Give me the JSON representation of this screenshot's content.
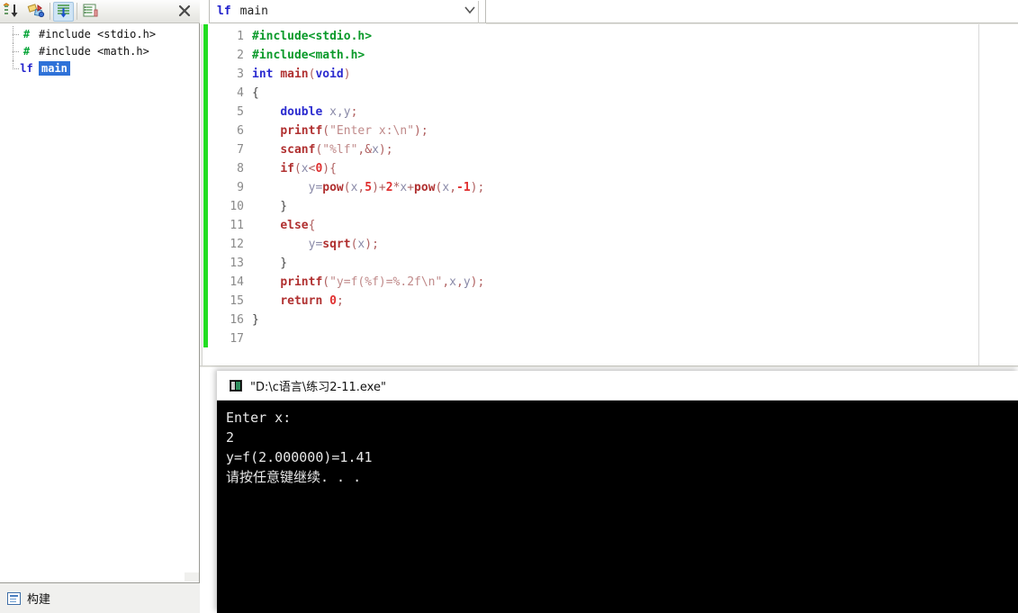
{
  "left_panel": {
    "toolbar": {
      "buttons": [
        {
          "name": "sort-alpha-icon",
          "label": ""
        },
        {
          "name": "shapes-icon",
          "label": ""
        },
        {
          "name": "outline-list-icon",
          "label": ""
        },
        {
          "name": "properties-list-icon",
          "label": ""
        }
      ],
      "close_label": "✕"
    },
    "tree": [
      {
        "icon": "hash-icon",
        "icon_glyph": "#",
        "label": "#include <stdio.h>",
        "selected": false
      },
      {
        "icon": "hash-icon",
        "icon_glyph": "#",
        "label": "#include <math.h>",
        "selected": false
      },
      {
        "icon": "function-icon",
        "icon_glyph": "lf",
        "label": "main",
        "selected": true
      }
    ],
    "status": {
      "icon": "build-log-icon",
      "label": "构建"
    }
  },
  "symbol_bar": {
    "icon": "function-icon",
    "icon_glyph": "lf",
    "label": "main",
    "chevron": "∨"
  },
  "editor": {
    "line_numbers": [
      "1",
      "2",
      "3",
      "4",
      "5",
      "6",
      "7",
      "8",
      "9",
      "10",
      "11",
      "12",
      "13",
      "14",
      "15",
      "16",
      "17"
    ],
    "lines": [
      "#include<stdio.h>",
      "#include<math.h>",
      "int main(void)",
      "{",
      "    double x,y;",
      "    printf(\"Enter x:\\n\");",
      "    scanf(\"%lf\",&x);",
      "    if(x<0){",
      "        y=pow(x,5)+2*x+pow(x,-1);",
      "    }",
      "    else{",
      "        y=sqrt(x);",
      "    }",
      "    printf(\"y=f(%f)=%.2f\\n\",x,y);",
      "    return 0;",
      "}",
      ""
    ],
    "colors": {
      "preprocessor": "#0a9a2a",
      "keyword": "#2c2cd0",
      "function": "#b03030",
      "string": "#c08a8a",
      "number": "#e03030",
      "identifier": "#8a8aa8",
      "gutter": "#8a8a8a",
      "change_bar": "#22dd22"
    }
  },
  "console": {
    "title": "\"D:\\c语言\\练习2-11.exe\"",
    "icon": "console-app-icon",
    "lines": [
      "Enter x:",
      "2",
      "y=f(2.000000)=1.41",
      "请按任意键继续. . ."
    ]
  }
}
